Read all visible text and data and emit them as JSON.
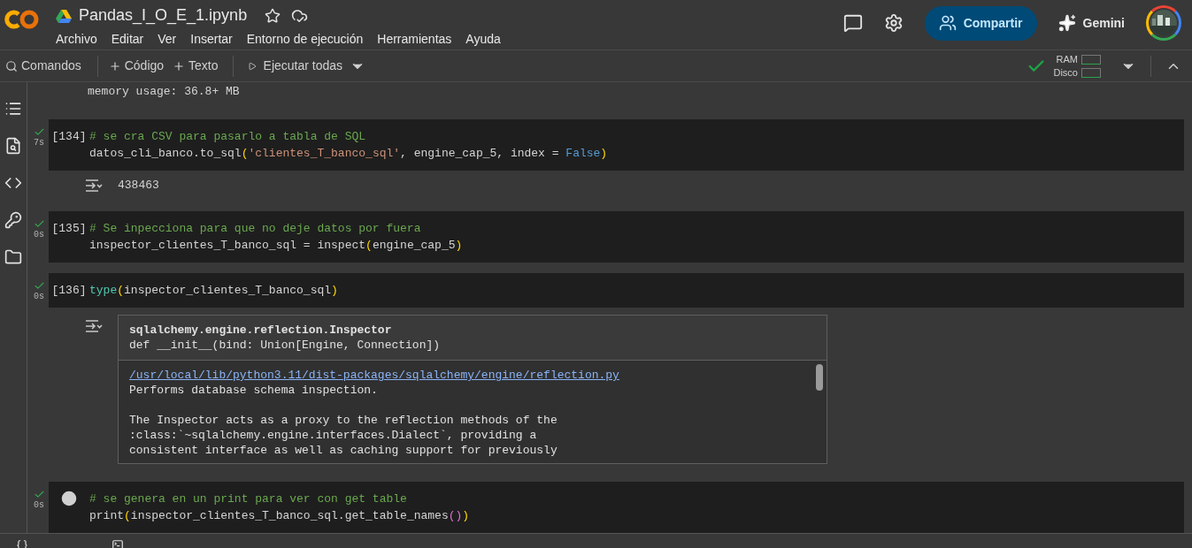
{
  "notebook": {
    "title": "Pandas_I_O_E_1.ipynb"
  },
  "menu": [
    "Archivo",
    "Editar",
    "Ver",
    "Insertar",
    "Entorno de ejecución",
    "Herramientas",
    "Ayuda"
  ],
  "header_actions": {
    "share": "Compartir",
    "gemini": "Gemini"
  },
  "toolbar": {
    "commands": "Comandos",
    "add_code": "Código",
    "add_text": "Texto",
    "run_all": "Ejecutar todas",
    "connected": true,
    "ram_label": "RAM",
    "disk_label": "Disco"
  },
  "previous_output": "memory usage: 36.8+ MB",
  "cells": [
    {
      "prompt": "[134]",
      "hovered": false,
      "executed": true,
      "duration": "7s",
      "lines": [
        [
          {
            "text": "# se cra CSV para pasarlo a tabla de SQL",
            "kind": "comment"
          }
        ],
        [
          {
            "text": "datos_cli_banco.to_sql",
            "kind": "plain"
          },
          {
            "text": "(",
            "kind": "paren"
          },
          {
            "text": "'clientes_T_banco_sql'",
            "kind": "string"
          },
          {
            "text": ", engine_cap_5, index = ",
            "kind": "plain"
          },
          {
            "text": "False",
            "kind": "keyword"
          },
          {
            "text": ")",
            "kind": "paren"
          }
        ]
      ],
      "output": {
        "kind": "text",
        "text": "438463"
      }
    },
    {
      "prompt": "[135]",
      "hovered": false,
      "executed": true,
      "duration": "0s",
      "lines": [
        [
          {
            "text": "# Se inpecciona para que no deje datos por fuera",
            "kind": "comment"
          }
        ],
        [
          {
            "text": "inspector_clientes_T_banco_sql = inspect",
            "kind": "plain"
          },
          {
            "text": "(",
            "kind": "paren"
          },
          {
            "text": "engine_cap_5",
            "kind": "plain"
          },
          {
            "text": ")",
            "kind": "paren"
          }
        ]
      ]
    },
    {
      "prompt": "[136]",
      "hovered": false,
      "executed": true,
      "duration": "0s",
      "lines": [
        [
          {
            "text": "type",
            "kind": "builtin"
          },
          {
            "text": "(",
            "kind": "paren"
          },
          {
            "text": "inspector_clientes_T_banco_sql",
            "kind": "plain"
          },
          {
            "text": ")",
            "kind": "paren"
          }
        ]
      ],
      "output": {
        "kind": "doc",
        "signature_title": "sqlalchemy.engine.reflection.Inspector",
        "signature": "def __init__(bind: Union[Engine, Connection])",
        "link": "/usr/local/lib/python3.11/dist-packages/sqlalchemy/engine/reflection.py",
        "paragraphs": [
          [
            "Performs database schema inspection."
          ],
          [
            "The Inspector acts as a proxy to the reflection methods of the",
            ":class:`~sqlalchemy.engine.interfaces.Dialect`, providing a",
            "consistent interface as well as caching support for previously"
          ]
        ]
      }
    },
    {
      "hovered": true,
      "executed": true,
      "duration": "0s",
      "lines": [
        [
          {
            "text": "# se genera en un print para ver con get table",
            "kind": "comment"
          }
        ],
        [
          {
            "text": "print",
            "kind": "plain"
          },
          {
            "text": "(",
            "kind": "paren"
          },
          {
            "text": "inspector_clientes_T_banco_sql.get_table_names",
            "kind": "plain"
          },
          {
            "text": "()",
            "kind": "paren2"
          },
          {
            "text": ")",
            "kind": "paren"
          }
        ]
      ]
    }
  ]
}
